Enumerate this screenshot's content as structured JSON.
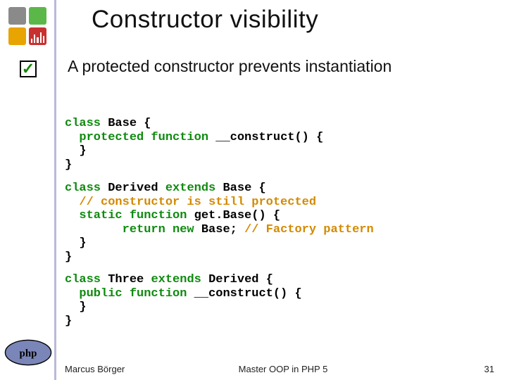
{
  "title": "Constructor visibility",
  "subtitle": "A protected constructor prevents instantiation",
  "checkbox_glyph": "✓",
  "code": {
    "b1_l1a": "class ",
    "b1_l1b": "Base ",
    "b1_l1c": "{",
    "b1_l2a": "  protected function ",
    "b1_l2b": "__construct",
    "b1_l2c": "() {",
    "b1_l3": "  }",
    "b1_l4": "}",
    "b2_l1a": "class ",
    "b2_l1b": "Derived ",
    "b2_l1c": "extends ",
    "b2_l1d": "Base ",
    "b2_l1e": "{",
    "b2_l2": "  // constructor is still protected",
    "b2_l3a": "  static function ",
    "b2_l3b": "get.Base",
    "b2_l3c": "() {",
    "b2_l4a": "        return new ",
    "b2_l4b": "Base",
    "b2_l4c": "; ",
    "b2_l4d": "// Factory pattern",
    "b2_l5": "  }",
    "b2_l6": "}",
    "b3_l1a": "class ",
    "b3_l1b": "Three ",
    "b3_l1c": "extends ",
    "b3_l1d": "Derived ",
    "b3_l1e": "{",
    "b3_l2a": "  public function ",
    "b3_l2b": "__construct",
    "b3_l2c": "() {",
    "b3_l3": "  }",
    "b3_l4": "}"
  },
  "footer": {
    "left": "Marcus Börger",
    "center": "Master OOP in PHP 5",
    "right": "31"
  }
}
